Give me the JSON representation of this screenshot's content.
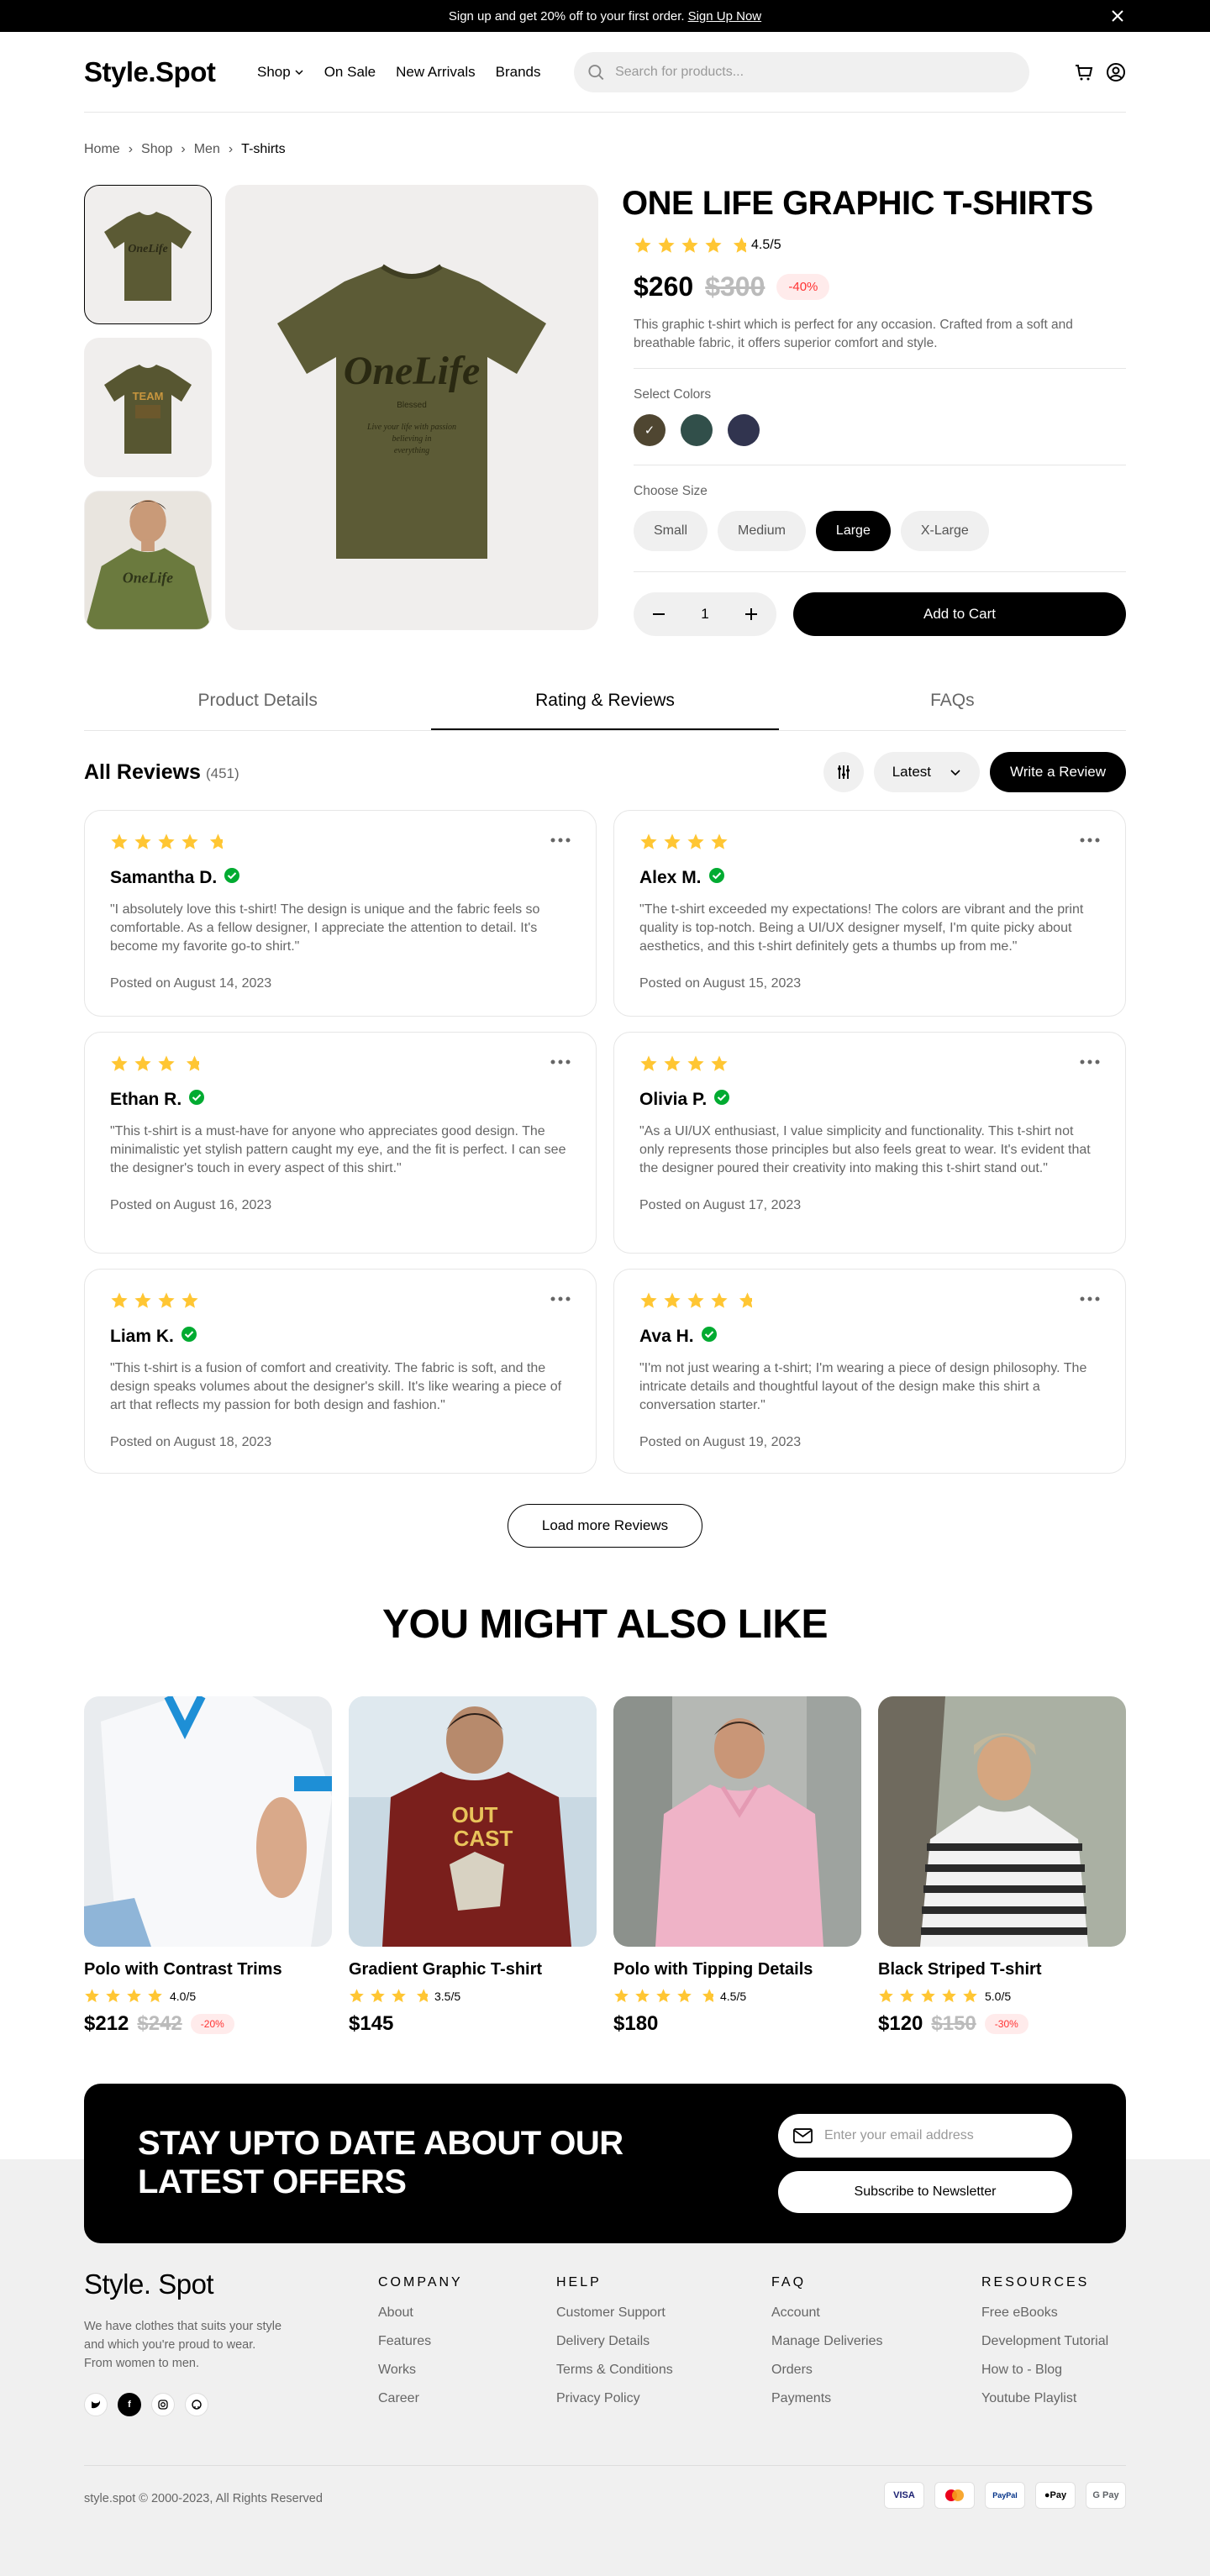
{
  "announcement": {
    "text": "Sign up and get 20% off to your first order.",
    "link": "Sign Up Now"
  },
  "header": {
    "logo": "Style.Spot",
    "nav": [
      "Shop",
      "On Sale",
      "New Arrivals",
      "Brands"
    ],
    "search_placeholder": "Search for products..."
  },
  "breadcrumb": [
    "Home",
    "Shop",
    "Men",
    "T-shirts"
  ],
  "product": {
    "title": "ONE LIFE GRAPHIC T-SHIRTS",
    "rating": 4.5,
    "rating_text": "4.5/5",
    "price": "$260",
    "old_price": "$300",
    "discount": "-40%",
    "description": "This graphic t-shirt which is perfect for any occasion. Crafted from a soft and breathable fabric, it offers superior comfort and style.",
    "colors_label": "Select Colors",
    "colors": [
      "#4f4631",
      "#314f4a",
      "#31344f"
    ],
    "size_label": "Choose Size",
    "sizes": [
      "Small",
      "Medium",
      "Large",
      "X-Large"
    ],
    "selected_size": "Large",
    "quantity": "1",
    "add_to_cart": "Add to Cart"
  },
  "tabs": [
    "Product Details",
    "Rating & Reviews",
    "FAQs"
  ],
  "reviews": {
    "title": "All Reviews",
    "count": "(451)",
    "sort": "Latest",
    "write": "Write a Review",
    "items": [
      {
        "name": "Samantha D.",
        "rating": 4.5,
        "text": "\"I absolutely love this t-shirt! The design is unique and the fabric feels so comfortable. As a fellow designer, I appreciate the attention to detail. It's become my favorite go-to shirt.\"",
        "date": "Posted on August 14, 2023"
      },
      {
        "name": "Alex M.",
        "rating": 4,
        "text": "\"The t-shirt exceeded my expectations! The colors are vibrant and the print quality is top-notch. Being a UI/UX designer myself, I'm quite picky about aesthetics, and this t-shirt definitely gets a thumbs up from me.\"",
        "date": "Posted on August 15, 2023"
      },
      {
        "name": "Ethan R.",
        "rating": 3.5,
        "text": "\"This t-shirt is a must-have for anyone who appreciates good design. The minimalistic yet stylish pattern caught my eye, and the fit is perfect. I can see the designer's touch in every aspect of this shirt.\"",
        "date": "Posted on August 16, 2023"
      },
      {
        "name": "Olivia P.",
        "rating": 4,
        "text": "\"As a UI/UX enthusiast, I value simplicity and functionality. This t-shirt not only represents those principles but also feels great to wear. It's evident that the designer poured their creativity into making this t-shirt stand out.\"",
        "date": "Posted on August 17, 2023"
      },
      {
        "name": "Liam K.",
        "rating": 4,
        "text": "\"This t-shirt is a fusion of comfort and creativity. The fabric is soft, and the design speaks volumes about the designer's skill. It's like wearing a piece of art that reflects my passion for both design and fashion.\"",
        "date": "Posted on August 18, 2023"
      },
      {
        "name": "Ava H.",
        "rating": 4.5,
        "text": "\"I'm not just wearing a t-shirt; I'm wearing a piece of design philosophy. The intricate details and thoughtful layout of the design make this shirt a conversation starter.\"",
        "date": "Posted on August 19, 2023"
      }
    ],
    "load_more": "Load more Reviews"
  },
  "related": {
    "title": "YOU MIGHT ALSO LIKE",
    "items": [
      {
        "name": "Polo with Contrast Trims",
        "rating": 4,
        "rating_text": "4.0/5",
        "price": "$212",
        "old_price": "$242",
        "discount": "-20%"
      },
      {
        "name": "Gradient Graphic T-shirt",
        "rating": 3.5,
        "rating_text": "3.5/5",
        "price": "$145",
        "old_price": "",
        "discount": ""
      },
      {
        "name": "Polo with Tipping Details",
        "rating": 4.5,
        "rating_text": "4.5/5",
        "price": "$180",
        "old_price": "",
        "discount": ""
      },
      {
        "name": "Black Striped T-shirt",
        "rating": 5,
        "rating_text": "5.0/5",
        "price": "$120",
        "old_price": "$150",
        "discount": "-30%"
      }
    ]
  },
  "newsletter": {
    "title": "STAY UPTO DATE ABOUT OUR LATEST OFFERS",
    "placeholder": "Enter your email address",
    "button": "Subscribe to Newsletter"
  },
  "footer": {
    "logo": "Style. Spot",
    "tagline": "We have clothes that suits your style and which you're proud to wear. From women to men.",
    "columns": [
      {
        "title": "COMPANY",
        "links": [
          "About",
          "Features",
          "Works",
          "Career"
        ]
      },
      {
        "title": "HELP",
        "links": [
          "Customer Support",
          "Delivery Details",
          "Terms & Conditions",
          "Privacy Policy"
        ]
      },
      {
        "title": "FAQ",
        "links": [
          "Account",
          "Manage Deliveries",
          "Orders",
          "Payments"
        ]
      },
      {
        "title": "RESOURCES",
        "links": [
          "Free eBooks",
          "Development Tutorial",
          "How to - Blog",
          "Youtube Playlist"
        ]
      }
    ],
    "copyright": "style.spot © 2000-2023, All Rights Reserved",
    "payments": [
      "VISA",
      "Mastercard",
      "PayPal",
      "Pay",
      "G Pay"
    ]
  }
}
